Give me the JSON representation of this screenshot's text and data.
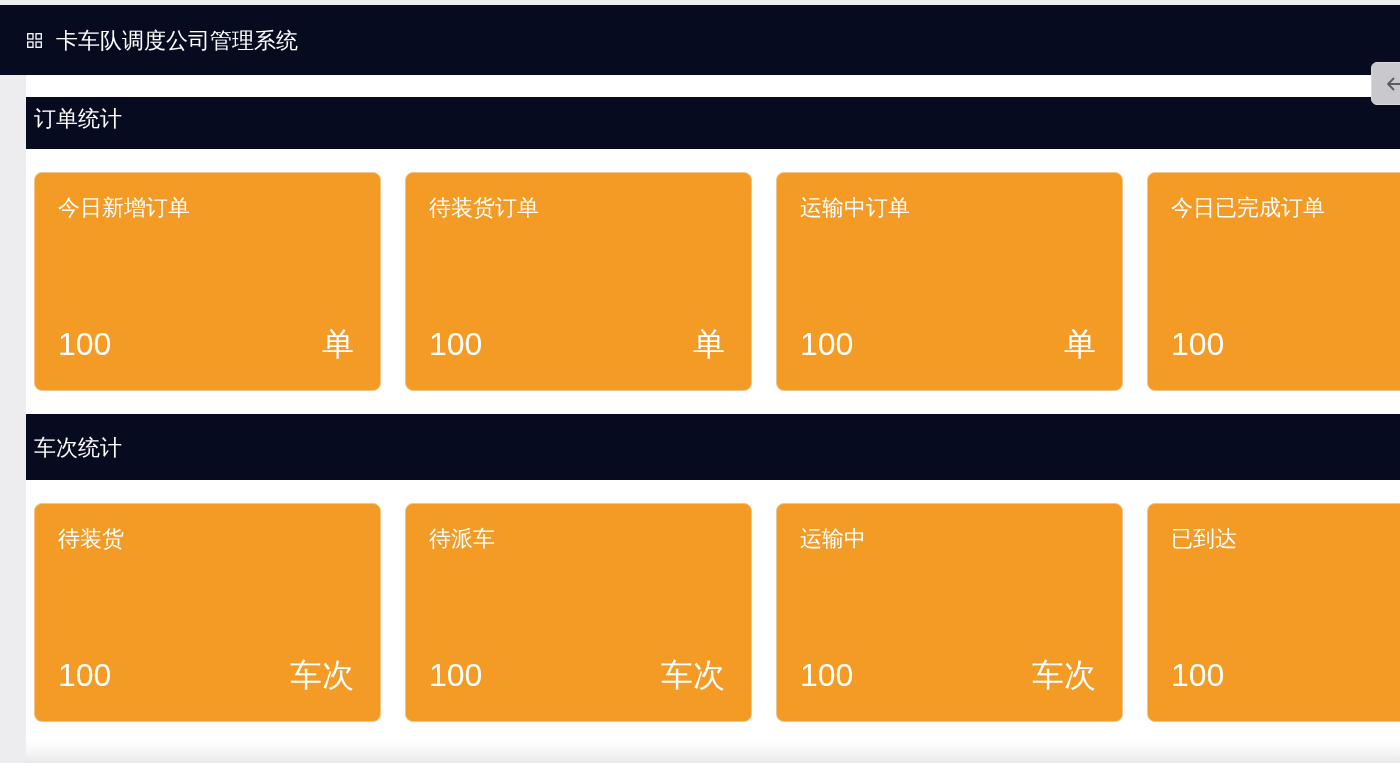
{
  "header": {
    "title": "卡车队调度公司管理系统"
  },
  "sections": [
    {
      "title": "订单统计",
      "cards": [
        {
          "label": "今日新增订单",
          "value": "100",
          "unit": "单"
        },
        {
          "label": "待装货订单",
          "value": "100",
          "unit": "单"
        },
        {
          "label": "运输中订单",
          "value": "100",
          "unit": "单"
        },
        {
          "label": "今日已完成订单",
          "value": "100"
        }
      ]
    },
    {
      "title": "车次统计",
      "cards": [
        {
          "label": "待装货",
          "value": "100",
          "unit": "车次"
        },
        {
          "label": "待派车",
          "value": "100",
          "unit": "车次"
        },
        {
          "label": "运输中",
          "value": "100",
          "unit": "车次"
        },
        {
          "label": "已到达",
          "value": "100"
        }
      ]
    }
  ]
}
